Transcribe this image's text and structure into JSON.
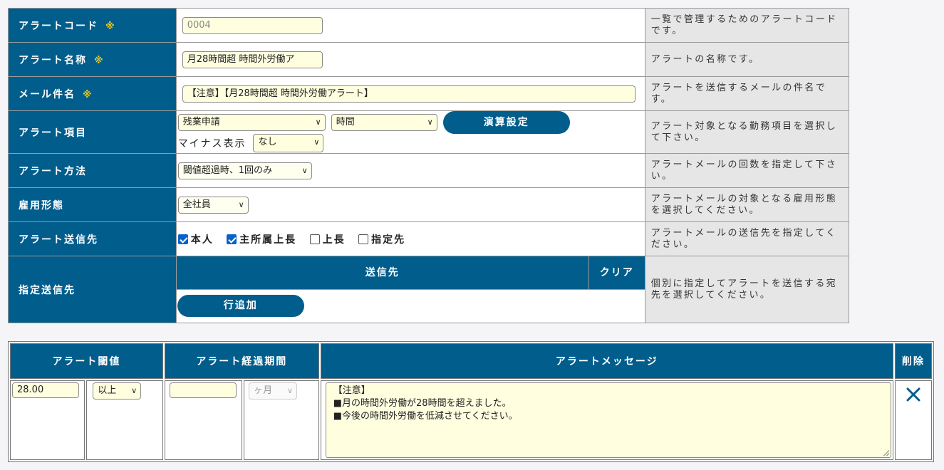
{
  "required_mark": "※",
  "rows": {
    "code": {
      "label": "アラートコード",
      "value": "0004",
      "desc": "一覧で管理するためのアラートコードです。"
    },
    "name": {
      "label": "アラート名称",
      "value": "月28時間超 時間外労働ア",
      "desc": "アラートの名称です。"
    },
    "subject": {
      "label": "メール件名",
      "value": "【注意】【月28時間超 時間外労働アラート】",
      "desc": "アラートを送信するメールの件名です。"
    },
    "item": {
      "label": "アラート項目",
      "select1": "残業申請",
      "select2": "時間",
      "calc_button": "演算設定",
      "minus_label": "マイナス表示",
      "minus_value": "なし",
      "desc": "アラート対象となる勤務項目を選択して下さい。"
    },
    "method": {
      "label": "アラート方法",
      "value": "閾値超過時、1回のみ",
      "desc": "アラートメールの回数を指定して下さい。"
    },
    "employment": {
      "label": "雇用形態",
      "value": "全社員",
      "desc": "アラートメールの対象となる雇用形態を選択してください。"
    },
    "recipients": {
      "label": "アラート送信先",
      "options": [
        {
          "label": "本人",
          "checked": true
        },
        {
          "label": "主所属上長",
          "checked": true
        },
        {
          "label": "上長",
          "checked": false
        },
        {
          "label": "指定先",
          "checked": false
        }
      ],
      "desc": "アラートメールの送信先を指定してください。"
    },
    "designated": {
      "label": "指定送信先",
      "col_dest": "送信先",
      "col_clear": "クリア",
      "add_row_button": "行追加",
      "desc": "個別に指定してアラートを送信する宛先を選択してください。"
    }
  },
  "alert_table": {
    "headers": {
      "threshold": "アラート閾値",
      "period": "アラート経過期間",
      "message": "アラートメッセージ",
      "delete": "削除"
    },
    "row": {
      "threshold_value": "28.00",
      "comparison": "以上",
      "period_value": "",
      "period_unit": "ヶ月",
      "message_lines": [
        "【注意】",
        "■月の時間外労働が28時間を超えました。",
        "■今後の時間外労働を低減させてください。"
      ],
      "delete_icon": "close-icon"
    }
  },
  "colors": {
    "header_blue": "#005d8c",
    "input_bg": "#ffffe0",
    "required_gold": "#e8c81c",
    "desc_bg": "#e6e6e6"
  }
}
